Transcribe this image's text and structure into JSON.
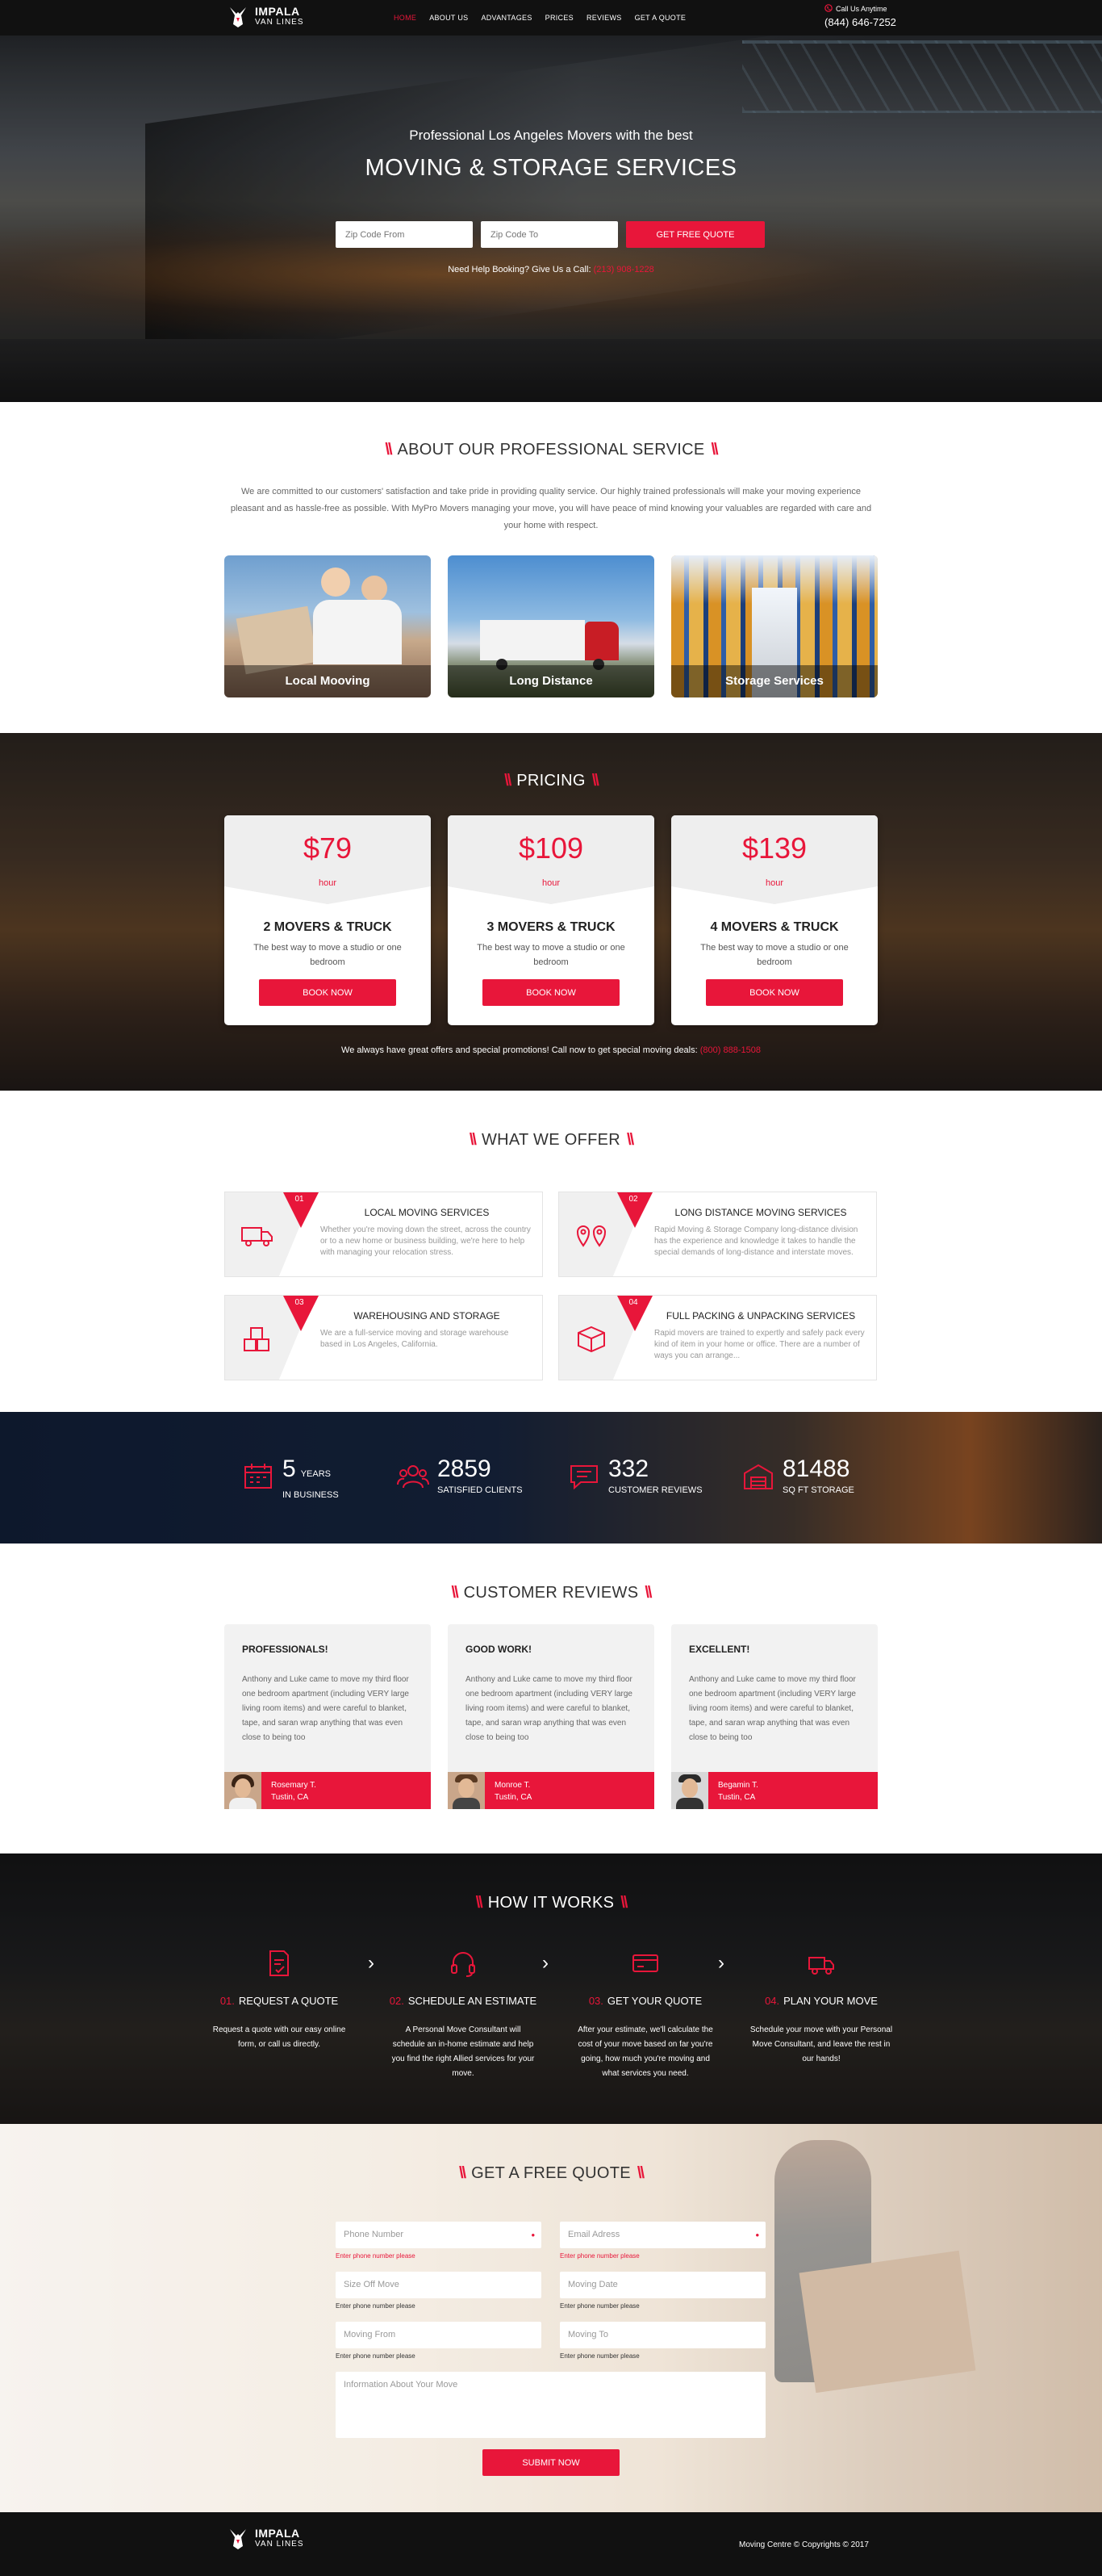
{
  "brand": {
    "name": "IMPALA",
    "sub": "VAN LINES"
  },
  "nav": {
    "items": [
      "HOME",
      "ABOUT US",
      "ADVANTAGES",
      "PRICES",
      "REVIEWS",
      "GET A QUOTE"
    ]
  },
  "call": {
    "label": "Call Us Anytime",
    "phone": "(844) 646-7252"
  },
  "hero": {
    "subtitle": "Professional Los Angeles Movers with the best",
    "title": "MOVING & STORAGE SERVICES",
    "zip_from_placeholder": "Zip Code From",
    "zip_to_placeholder": "Zip Code To",
    "button": "GET FREE QUOTE",
    "help_text": "Need Help Booking? Give Us a Call:",
    "help_phone": "(213) 908-1228"
  },
  "about": {
    "title": "ABOUT OUR PROFESSIONAL SERVICE",
    "text": "We are committed to our customers' satisfaction and take pride in providing quality service. Our highly trained professionals will make your moving experience pleasant and as hassle-free as possible. With MyPro Movers managing your move, you will have peace of mind knowing your valuables are regarded with care and your home with respect.",
    "services": [
      "Local Mooving",
      "Long Distance",
      "Storage Services"
    ]
  },
  "pricing": {
    "title": "PRICING",
    "plans": [
      {
        "price": "$79",
        "unit": "hour",
        "name": "2 MOVERS & TRUCK",
        "desc": "The best way to move a studio or one bedroom",
        "button": "BOOK NOW"
      },
      {
        "price": "$109",
        "unit": "hour",
        "name": "3 MOVERS & TRUCK",
        "desc": "The best way to move a studio or one bedroom",
        "button": "BOOK NOW"
      },
      {
        "price": "$139",
        "unit": "hour",
        "name": "4 MOVERS & TRUCK",
        "desc": "The best way to move a studio or one bedroom",
        "button": "BOOK NOW"
      }
    ],
    "offers_text": "We always have great offers and special promotions! Call now to get special moving deals:",
    "offers_phone": "(800) 888-1508"
  },
  "offer": {
    "title": "WHAT WE OFFER",
    "items": [
      {
        "num": "01",
        "title": "LOCAL MOVING SERVICES",
        "text": "Whether you're moving down the street, across the country or to a new home or business building, we're here to help with managing your relocation stress."
      },
      {
        "num": "02",
        "title": "LONG DISTANCE MOVING SERVICES",
        "text": "Rapid Moving & Storage Company long-distance division has the experience and knowledge it takes to handle the special demands of long-distance and interstate moves."
      },
      {
        "num": "03",
        "title": "WAREHOUSING AND STORAGE",
        "text": "We are a full-service moving and storage warehouse based in Los Angeles, California."
      },
      {
        "num": "04",
        "title": "FULL PACKING & UNPACKING SERVICES",
        "text": "Rapid movers are trained to expertly and safely pack every kind of item in your home or office. There are a number of ways you can arrange..."
      }
    ]
  },
  "stats": [
    {
      "value": "5",
      "unit": "YEARS",
      "label": "IN BUSINESS"
    },
    {
      "value": "2859",
      "unit": "",
      "label": "SATISFIED CLIENTS"
    },
    {
      "value": "332",
      "unit": "",
      "label": "CUSTOMER REVIEWS"
    },
    {
      "value": "81488",
      "unit": "",
      "label": "SQ FT STORAGE"
    }
  ],
  "reviews": {
    "title": "CUSTOMER REVIEWS",
    "items": [
      {
        "heading": "PROFESSIONALS!",
        "text": "Anthony and Luke came to move my third floor one bedroom apartment (including VERY large living room items) and were careful to blanket, tape, and saran wrap anything that was even close to being too",
        "name": "Rosemary T.",
        "place": "Tustin, CA"
      },
      {
        "heading": "GOOD WORK!",
        "text": "Anthony and Luke came to move my third floor one bedroom apartment (including VERY large living room items) and were careful to blanket, tape, and saran wrap anything that was even close to being too",
        "name": "Monroe T.",
        "place": "Tustin, CA"
      },
      {
        "heading": "EXCELLENT!",
        "text": "Anthony and Luke came to move my third floor one bedroom apartment (including VERY large living room items) and were careful to blanket, tape, and saran wrap anything that was even close to being too",
        "name": "Begamin T.",
        "place": "Tustin, CA"
      }
    ]
  },
  "how": {
    "title": "HOW IT WORKS",
    "steps": [
      {
        "num": "01.",
        "title": "REQUEST A QUOTE",
        "text": "Request a quote with our easy online form, or call us directly."
      },
      {
        "num": "02.",
        "title": "SCHEDULE AN ESTIMATE",
        "text": "A Personal Move Consultant will schedule an in-home estimate and help you find the right Allied services for your move."
      },
      {
        "num": "03.",
        "title": "GET YOUR QUOTE",
        "text": "After your estimate, we'll calculate the cost of your move based on far you're going, how much you're moving and what services you need."
      },
      {
        "num": "04.",
        "title": "PLAN YOUR MOVE",
        "text": "Schedule your move with your Personal Move Consultant, and leave the rest in our hands!"
      }
    ]
  },
  "quote": {
    "title": "GET A FREE QUOTE",
    "fields": [
      {
        "placeholder": "Phone Number",
        "hint": "Enter phone number please"
      },
      {
        "placeholder": "Email Adress",
        "hint": "Enter phone number please"
      },
      {
        "placeholder": "Size Off Move",
        "hint": "Enter phone number please"
      },
      {
        "placeholder": "Moving Date",
        "hint": "Enter phone number please"
      },
      {
        "placeholder": "Moving From",
        "hint": "Enter phone number please"
      },
      {
        "placeholder": "Moving To",
        "hint": "Enter phone number please"
      }
    ],
    "info_placeholder": "Information About Your Move",
    "button": "SUBMIT NOW"
  },
  "footer": {
    "copyright": "Moving Centre © Copyrights © 2017"
  },
  "colors": {
    "accent": "#e8163a",
    "dark": "#111111"
  }
}
